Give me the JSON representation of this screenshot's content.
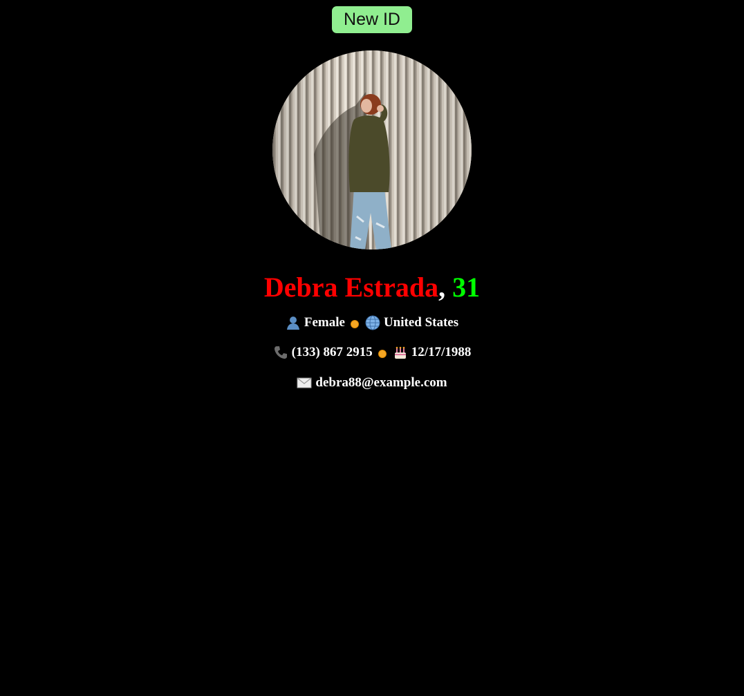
{
  "button": {
    "label": "New ID"
  },
  "avatar": {
    "alt": "profile photo",
    "icon": "person-photo"
  },
  "person": {
    "name": "Debra Estrada",
    "comma": ",",
    "age": "31",
    "gender": "Female",
    "country": "United States",
    "phone": "(133) 867 2915",
    "birthday": "12/17/1988",
    "email": "debra88@example.com"
  },
  "icons": {
    "gender": "person-icon",
    "country": "globe-icon",
    "phone": "phone-icon",
    "birthday": "cake-icon",
    "email": "envelope-icon",
    "separator": "orange-dot-icon"
  },
  "colors": {
    "background": "#000000",
    "button": "#90ee90",
    "name": "#ff0000",
    "age": "#00ff00",
    "text": "#ffffff",
    "separator": "#f5a623"
  }
}
